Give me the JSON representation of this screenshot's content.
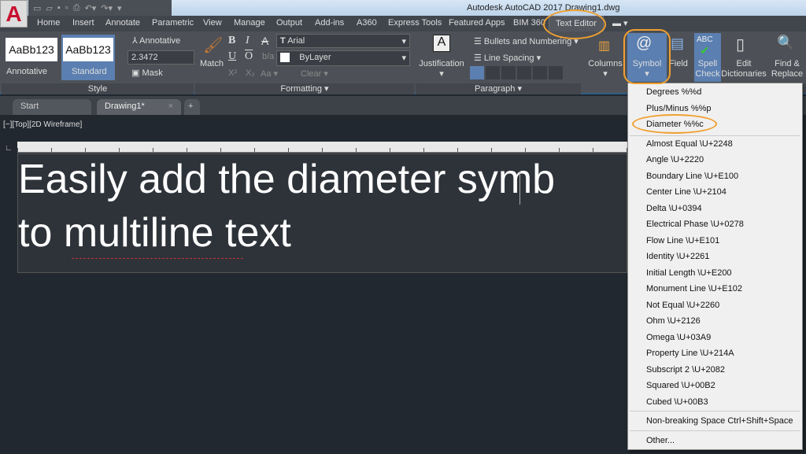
{
  "window": {
    "title": "Autodesk AutoCAD 2017    Drawing1.dwg",
    "app_letter": "A"
  },
  "ribbon_tabs": [
    "Home",
    "Insert",
    "Annotate",
    "Parametric",
    "View",
    "Manage",
    "Output",
    "Add-ins",
    "A360",
    "Express Tools",
    "Featured Apps",
    "BIM 360",
    "Text Editor"
  ],
  "style_panel": {
    "title": "Style",
    "swatch1": "AaBb123",
    "swatch1_label": "Annotative",
    "swatch2": "AaBb123",
    "swatch2_label": "Standard",
    "annotative": "Annotative",
    "height": "2.3472",
    "mask": "Mask"
  },
  "formatting_panel": {
    "title": "Formatting ▾",
    "match": "Match",
    "font": "Arial",
    "color": "ByLayer",
    "case": "Aa ▾",
    "clear": "Clear ▾"
  },
  "paragraph_panel": {
    "title": "Paragraph ▾",
    "justification": "Justification",
    "bullets": "Bullets and Numbering ▾",
    "line_spacing": "Line Spacing ▾"
  },
  "insert_panel": {
    "columns": "Columns",
    "symbol": "Symbol",
    "field": "Field"
  },
  "spell_panel": {
    "spell_check": "Spell Check",
    "edit_dict": "Edit Dictionaries",
    "find_replace": "Find & Replace"
  },
  "doc_tabs": {
    "start": "Start",
    "drawing": "Drawing1*"
  },
  "viewport_label": "[−][Top][2D Wireframe]",
  "editor_text": [
    "Easily add the diameter  symb",
    "to multiline text"
  ],
  "symbol_menu": [
    "Degrees  %%d",
    "Plus/Minus  %%p",
    "Diameter  %%c",
    "Almost Equal  \\U+2248",
    "Angle  \\U+2220",
    "Boundary Line  \\U+E100",
    "Center Line  \\U+2104",
    "Delta  \\U+0394",
    "Electrical Phase  \\U+0278",
    "Flow Line  \\U+E101",
    "Identity  \\U+2261",
    "Initial Length  \\U+E200",
    "Monument Line  \\U+E102",
    "Not Equal  \\U+2260",
    "Ohm  \\U+2126",
    "Omega  \\U+03A9",
    "Property Line  \\U+214A",
    "Subscript 2  \\U+2082",
    "Squared  \\U+00B2",
    "Cubed  \\U+00B3",
    "Non-breaking Space Ctrl+Shift+Space",
    "Other..."
  ],
  "colors": {
    "highlight": "#f0a030",
    "accent": "#5b7fb0"
  }
}
